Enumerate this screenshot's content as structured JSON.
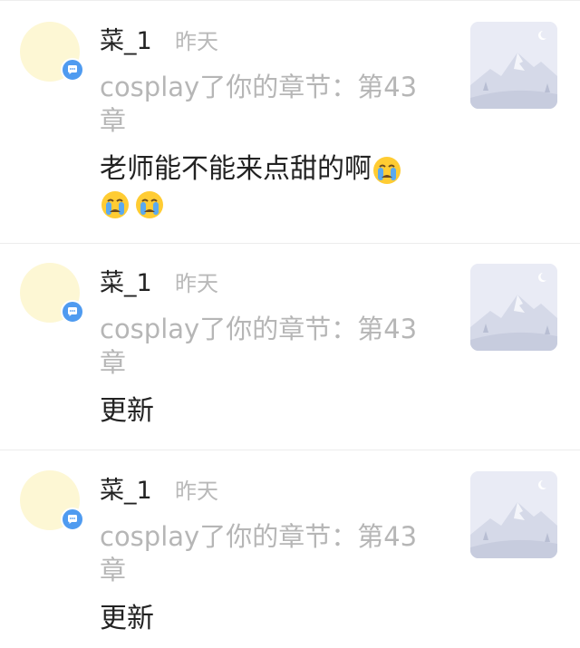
{
  "messages": [
    {
      "username": "菜_1",
      "time": "昨天",
      "action": "cosplay了你的章节：第43章",
      "content": "老师能不能来点甜的啊",
      "emoji_count": 3,
      "emoji": "crying-face-icon"
    },
    {
      "username": "菜_1",
      "time": "昨天",
      "action": "cosplay了你的章节：第43章",
      "content": "更新",
      "emoji_count": 0
    },
    {
      "username": "菜_1",
      "time": "昨天",
      "action": "cosplay了你的章节：第43章",
      "content": "更新",
      "emoji_count": 0
    }
  ],
  "colors": {
    "avatar_bg": "#fdf7d4",
    "badge": "#4f9bf0",
    "thumbnail_bg": "#e9ebf5",
    "secondary_text": "#b6b6b6",
    "primary_text": "#222222"
  }
}
